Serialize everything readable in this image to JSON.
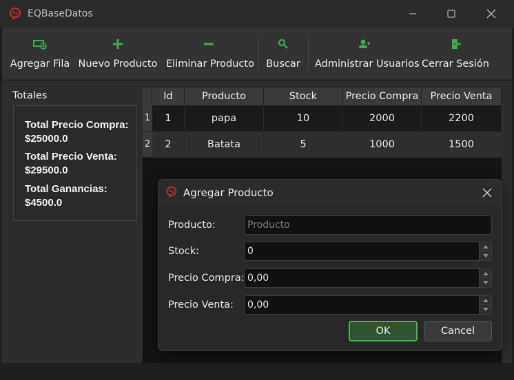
{
  "window": {
    "title": "EQBaseDatos",
    "icon": "app-logo-icon",
    "accent_icon_color": "#c62828"
  },
  "toolbar": {
    "icon_color": "#3fae49",
    "buttons": [
      {
        "label": "Agregar Fila",
        "icon": "add-row-icon"
      },
      {
        "label": "Nuevo Producto",
        "icon": "plus-icon"
      },
      {
        "label": "Eliminar Producto",
        "icon": "minus-icon"
      },
      {
        "label": "Buscar",
        "icon": "search-icon"
      },
      {
        "label": "Administrar Usuarios",
        "icon": "user-add-icon"
      },
      {
        "label": "Cerrar Sesión",
        "icon": "logout-icon"
      }
    ]
  },
  "totals": {
    "label": "Totales",
    "compra_label": "Total Precio Compra:",
    "compra_value": "$25000.0",
    "venta_label": "Total Precio Venta:",
    "venta_value": "$29500.0",
    "ganancias_label": "Total Ganancias:",
    "ganancias_value": "$4500.0"
  },
  "table": {
    "headers": [
      "Id",
      "Producto",
      "Stock",
      "Precio Compra",
      "Precio Venta"
    ],
    "rows": [
      {
        "row_header": "1",
        "cells": [
          "1",
          "papa",
          "10",
          "2000",
          "2200"
        ]
      },
      {
        "row_header": "2",
        "cells": [
          "2",
          "Batata",
          "5",
          "1000",
          "1500"
        ]
      }
    ]
  },
  "dialog": {
    "title": "Agregar Producto",
    "fields": {
      "producto_label": "Producto:",
      "producto_placeholder": "Producto",
      "producto_value": "",
      "stock_label": "Stock:",
      "stock_value": "0",
      "precio_compra_label": "Precio Compra:",
      "precio_compra_value": "0,00",
      "precio_venta_label": "Precio Venta:",
      "precio_venta_value": "0,00"
    },
    "ok_label": "OK",
    "cancel_label": "Cancel"
  }
}
